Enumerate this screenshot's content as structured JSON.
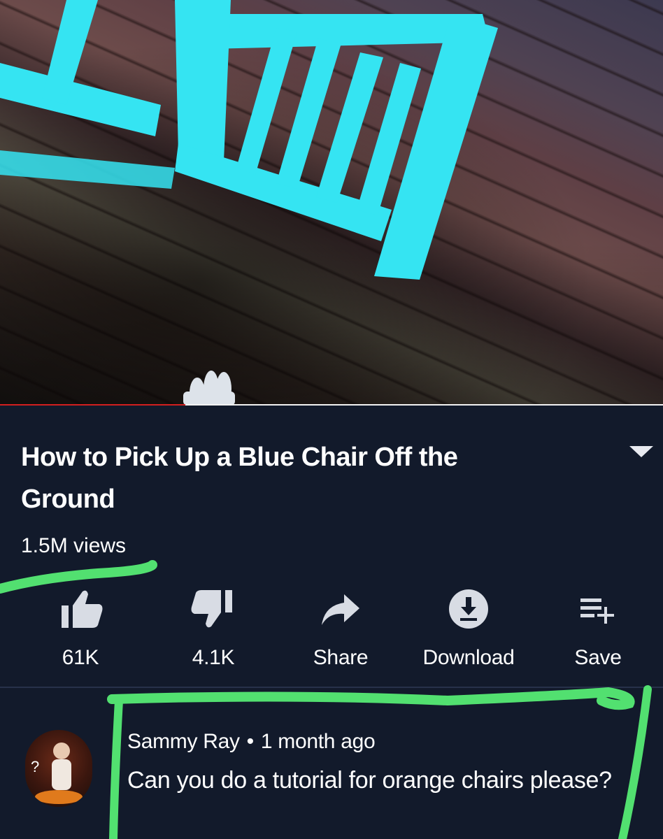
{
  "video": {
    "progress_fraction": 0.28
  },
  "info": {
    "title": "How to Pick Up a Blue Chair Off the Ground",
    "views": "1.5M views"
  },
  "actions": [
    {
      "label": "61K",
      "icon": "thumbs-up-icon"
    },
    {
      "label": "4.1K",
      "icon": "thumbs-down-icon"
    },
    {
      "label": "Share",
      "icon": "share-arrow-icon"
    },
    {
      "label": "Download",
      "icon": "download-icon"
    },
    {
      "label": "Save",
      "icon": "playlist-add-icon"
    }
  ],
  "comment": {
    "author": "Sammy Ray",
    "separator": "•",
    "time": "1 month ago",
    "text": "Can you do a tutorial for orange chairs please?"
  },
  "colors": {
    "background": "#121a2b",
    "progress": "#d21f1f",
    "chair": "#35e4f2",
    "highlight_marker": "#52e070"
  }
}
